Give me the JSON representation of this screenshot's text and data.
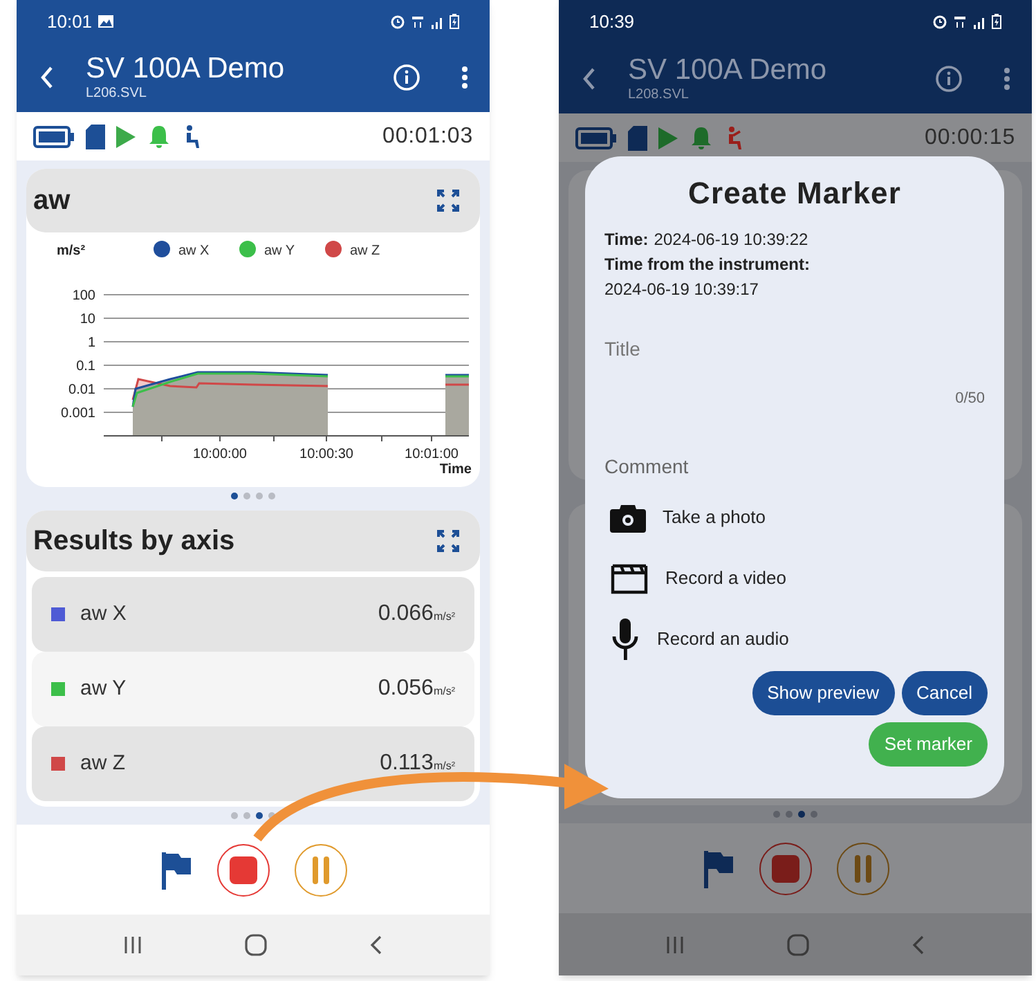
{
  "phones": [
    {
      "dimmed": false,
      "status_bar": {
        "time": "10:01",
        "gallery_notification": true
      },
      "app_bar": {
        "title": "SV 100A Demo",
        "subtitle": "L206.SVL"
      },
      "toolbar": {
        "alert": false,
        "timer": "00:01:03"
      },
      "chart_card": {
        "title": "aw",
        "chart": {
          "y_unit": "m/s²",
          "x_title": "Time",
          "legend": [
            {
              "name": "aw X",
              "color": "#1f4e9c"
            },
            {
              "name": "aw Y",
              "color": "#3cbf4a"
            },
            {
              "name": "aw Z",
              "color": "#d04848"
            }
          ],
          "y_tick_labels": [
            "100",
            "10",
            "1",
            "0.1",
            "0.01",
            "0.001"
          ],
          "x_tick_labels": [
            "10:00:00",
            "10:00:30",
            "10:01:00"
          ]
        }
      },
      "chart_pager": [
        {
          "selected": true
        },
        {
          "selected": false
        },
        {
          "selected": false
        },
        {
          "selected": false
        }
      ],
      "results_card": {
        "title": "Results by axis",
        "rows": [
          {
            "name": "aw X",
            "value": "0.066",
            "unit": "m/s²",
            "color": "#4f5bd5"
          },
          {
            "name": "aw Y",
            "value": "0.056",
            "unit": "m/s²",
            "color": "#3cbf4a"
          },
          {
            "name": "aw Z",
            "value": "0.113",
            "unit": "m/s²",
            "color": "#d04848"
          }
        ]
      },
      "results_pager": [
        {
          "selected": false
        },
        {
          "selected": false
        },
        {
          "selected": true
        },
        {
          "selected": false
        }
      ]
    },
    {
      "dimmed": true,
      "status_bar": {
        "time": "10:39",
        "gallery_notification": false
      },
      "app_bar": {
        "title": "SV 100A Demo",
        "subtitle": "L208.SVL"
      },
      "toolbar": {
        "alert": true,
        "timer": "00:00:15"
      },
      "results_pager": [
        {
          "selected": false
        },
        {
          "selected": false
        },
        {
          "selected": true
        },
        {
          "selected": false
        }
      ],
      "dialog": {
        "title": "Create Marker",
        "time_label": "Time:",
        "time_value": "2024-06-19 10:39:22",
        "instrument_label": "Time from the instrument:",
        "instrument_value": "2024-06-19 10:39:17",
        "title_field": {
          "placeholder": "Title",
          "counter": "0/50"
        },
        "comment_field": {
          "placeholder": "Comment"
        },
        "actions": [
          {
            "kind": "photo",
            "label": "Take a photo"
          },
          {
            "kind": "video",
            "label": "Record a video"
          },
          {
            "kind": "audio",
            "label": "Record an audio"
          }
        ],
        "buttons": [
          {
            "kind": "primary",
            "label": "Show preview"
          },
          {
            "kind": "primary",
            "label": "Cancel"
          },
          {
            "kind": "success",
            "label": "Set marker"
          }
        ]
      }
    }
  ]
}
